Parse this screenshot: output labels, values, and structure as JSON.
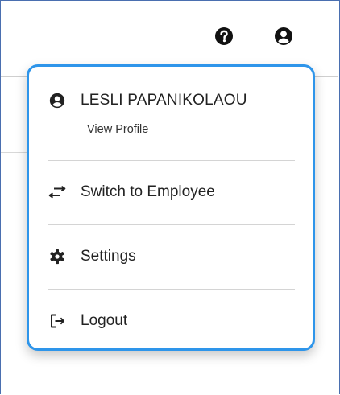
{
  "header": {
    "help_icon": "question-circle-icon",
    "account_icon": "user-circle-icon"
  },
  "menu": {
    "user": {
      "name": "LESLI PAPANIKOLAOU",
      "link": "View Profile",
      "icon": "user-circle-icon"
    },
    "items": [
      {
        "label": "Switch to Employee",
        "icon": "switch-arrows-icon"
      },
      {
        "label": "Settings",
        "icon": "gear-icon"
      },
      {
        "label": "Logout",
        "icon": "logout-icon"
      }
    ]
  },
  "colors": {
    "accent": "#2e95ea",
    "text": "#222222",
    "divider": "#d4d4d4"
  }
}
